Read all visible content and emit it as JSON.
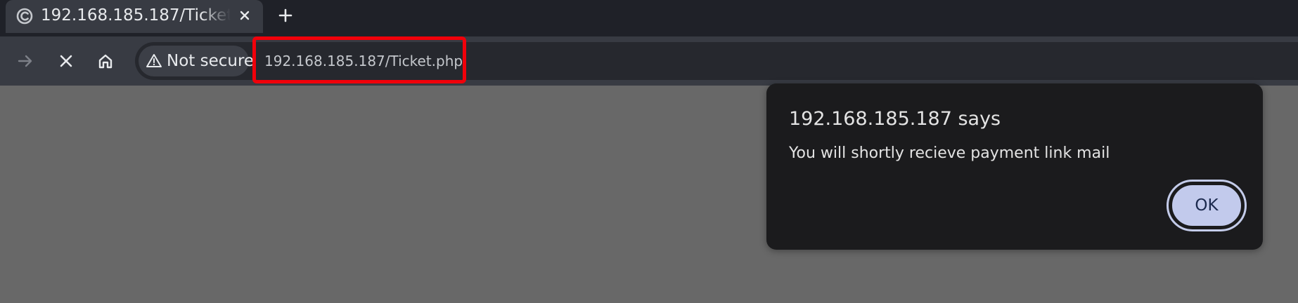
{
  "browser": {
    "tab": {
      "title": "192.168.185.187/Ticket.php",
      "favicon": "loading-spinner-icon",
      "close_icon": "close-icon"
    },
    "new_tab_icon": "plus-icon",
    "toolbar": {
      "forward_icon": "arrow-right-icon",
      "stop_icon": "close-icon",
      "home_icon": "home-icon"
    },
    "omnibox": {
      "security_label": "Not secure",
      "security_icon": "warning-triangle-icon",
      "url": "192.168.185.187/Ticket.php",
      "highlight_color": "#f0000a"
    }
  },
  "alert_dialog": {
    "title": "192.168.185.187 says",
    "message": "You will shortly recieve payment link mail",
    "ok_label": "OK",
    "button_color": "#c2caec"
  },
  "page": {
    "background_color": "#686868"
  }
}
